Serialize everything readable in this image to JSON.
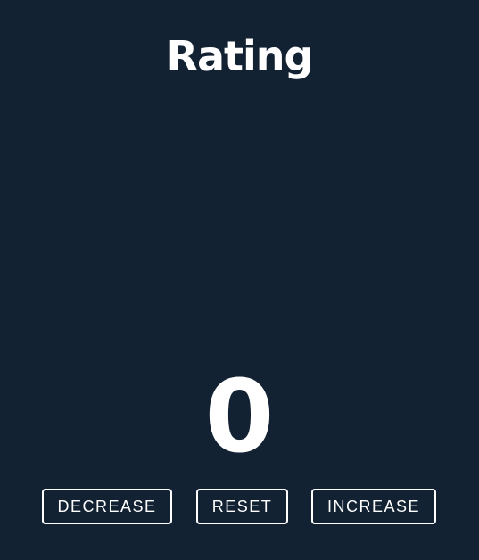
{
  "page": {
    "title": "Rating"
  },
  "counter": {
    "value": "0"
  },
  "buttons": {
    "decrease_label": "DECREASE",
    "reset_label": "RESET",
    "increase_label": "INCREASE"
  },
  "colors": {
    "background": "#122233",
    "foreground": "#ffffff"
  }
}
